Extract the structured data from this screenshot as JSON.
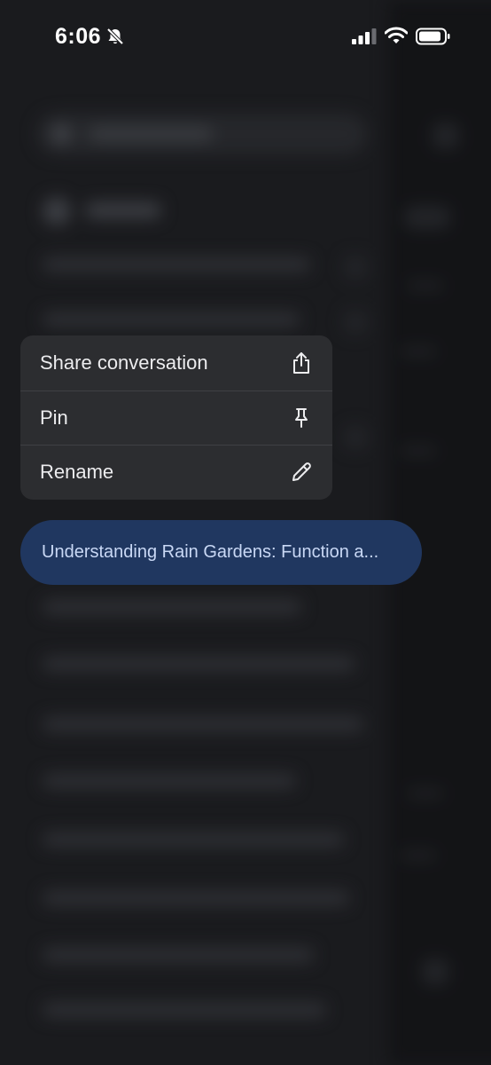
{
  "status_bar": {
    "time": "6:06",
    "icons": [
      "bell-slash-icon",
      "cellular-signal-icon",
      "wifi-icon",
      "battery-icon"
    ]
  },
  "context_menu": {
    "items": [
      {
        "label": "Share conversation",
        "icon": "share-icon"
      },
      {
        "label": "Pin",
        "icon": "pin-icon"
      },
      {
        "label": "Rename",
        "icon": "pencil-icon"
      }
    ]
  },
  "selected_conversation": {
    "title": "Understanding Rain Gardens: Function a..."
  },
  "colors": {
    "menu_background": "#2c2d30",
    "chip_background": "#203760",
    "chip_text": "#c9d8f5"
  }
}
